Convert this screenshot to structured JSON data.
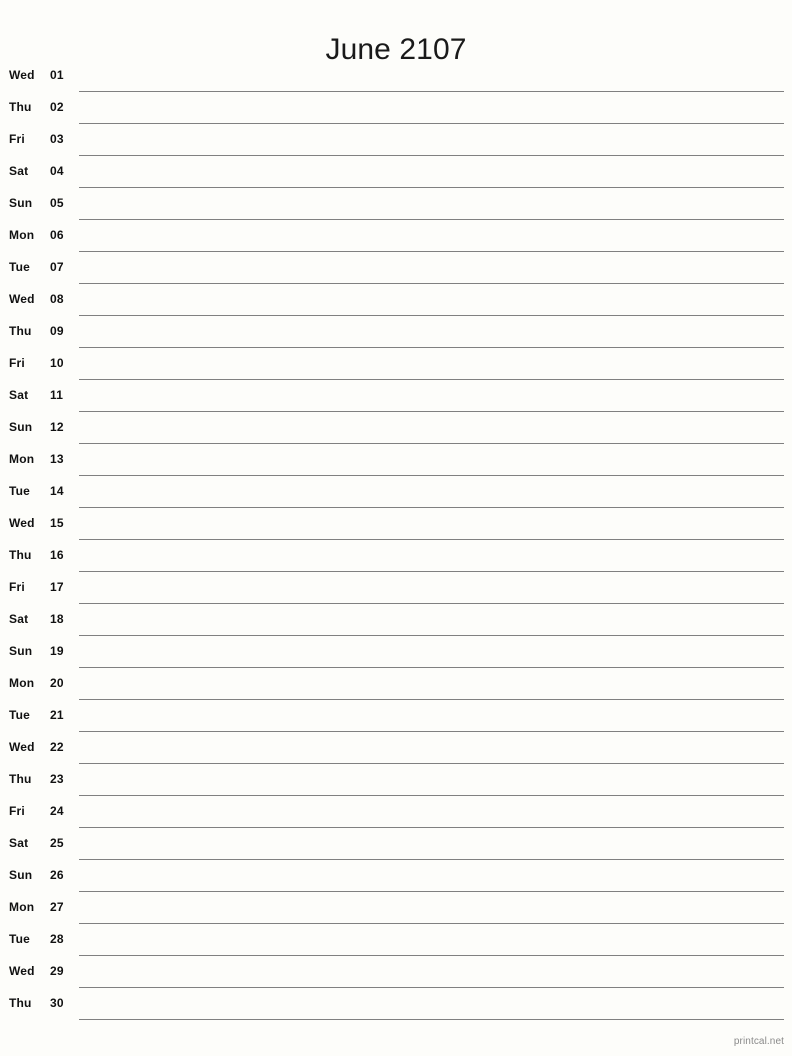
{
  "header": {
    "title": "June 2107",
    "month": "June",
    "year": "2107"
  },
  "footer": {
    "credit": "printcal.net"
  },
  "colors": {
    "page_background": "#fdfdfa",
    "text": "#111111",
    "title_text": "#1a1a1a",
    "rule_line": "#808080",
    "footer_text": "#8a8a8a"
  },
  "calendar": {
    "layout": "single-column-notes",
    "days": [
      {
        "weekday": "Wed",
        "daynum": "01"
      },
      {
        "weekday": "Thu",
        "daynum": "02"
      },
      {
        "weekday": "Fri",
        "daynum": "03"
      },
      {
        "weekday": "Sat",
        "daynum": "04"
      },
      {
        "weekday": "Sun",
        "daynum": "05"
      },
      {
        "weekday": "Mon",
        "daynum": "06"
      },
      {
        "weekday": "Tue",
        "daynum": "07"
      },
      {
        "weekday": "Wed",
        "daynum": "08"
      },
      {
        "weekday": "Thu",
        "daynum": "09"
      },
      {
        "weekday": "Fri",
        "daynum": "10"
      },
      {
        "weekday": "Sat",
        "daynum": "11"
      },
      {
        "weekday": "Sun",
        "daynum": "12"
      },
      {
        "weekday": "Mon",
        "daynum": "13"
      },
      {
        "weekday": "Tue",
        "daynum": "14"
      },
      {
        "weekday": "Wed",
        "daynum": "15"
      },
      {
        "weekday": "Thu",
        "daynum": "16"
      },
      {
        "weekday": "Fri",
        "daynum": "17"
      },
      {
        "weekday": "Sat",
        "daynum": "18"
      },
      {
        "weekday": "Sun",
        "daynum": "19"
      },
      {
        "weekday": "Mon",
        "daynum": "20"
      },
      {
        "weekday": "Tue",
        "daynum": "21"
      },
      {
        "weekday": "Wed",
        "daynum": "22"
      },
      {
        "weekday": "Thu",
        "daynum": "23"
      },
      {
        "weekday": "Fri",
        "daynum": "24"
      },
      {
        "weekday": "Sat",
        "daynum": "25"
      },
      {
        "weekday": "Sun",
        "daynum": "26"
      },
      {
        "weekday": "Mon",
        "daynum": "27"
      },
      {
        "weekday": "Tue",
        "daynum": "28"
      },
      {
        "weekday": "Wed",
        "daynum": "29"
      },
      {
        "weekday": "Thu",
        "daynum": "30"
      }
    ]
  }
}
